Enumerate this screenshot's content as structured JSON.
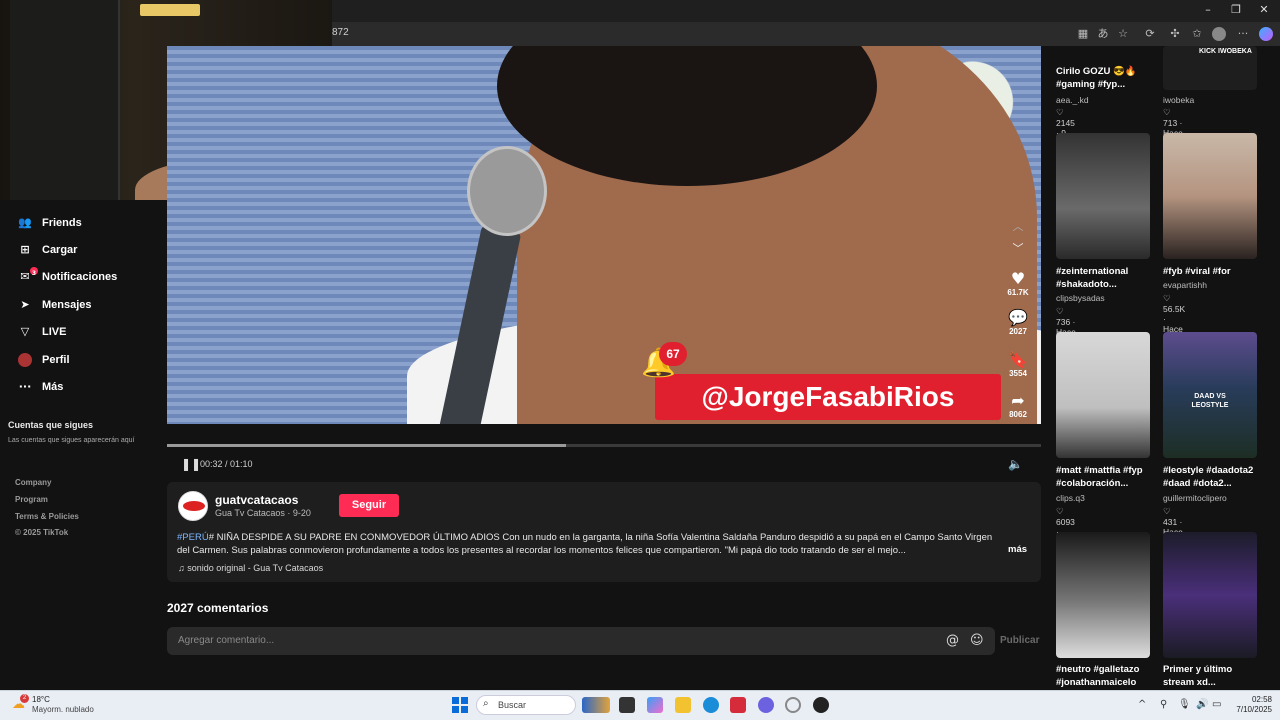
{
  "browser": {
    "url": "872",
    "icons": [
      "grid-icon",
      "translate-icon",
      "star-icon",
      "extension-icon",
      "puzzle-icon",
      "favorites-icon",
      "profile-icon",
      "more-icon",
      "copilot-icon"
    ]
  },
  "sidebar": {
    "items": [
      {
        "label": "Friends",
        "icon": "friends-icon"
      },
      {
        "label": "Cargar",
        "icon": "upload-icon"
      },
      {
        "label": "Notificaciones",
        "icon": "bell-icon",
        "badge": "3"
      },
      {
        "label": "Mensajes",
        "icon": "message-icon"
      },
      {
        "label": "LIVE",
        "icon": "live-icon"
      },
      {
        "label": "Perfil",
        "icon": "profile-icon"
      },
      {
        "label": "Más",
        "icon": "more-icon"
      }
    ],
    "following_title": "Cuentas que sigues",
    "following_note": "Las cuentas que sigues aparecerán aquí",
    "footer": [
      "Company",
      "Program",
      "Terms & Policies",
      "© 2025 TikTok"
    ]
  },
  "video": {
    "overlay_handle": "@JorgeFasabiRios",
    "bell_badge": "67",
    "likes": "61.7K",
    "comments": "2027",
    "saves": "3554",
    "shares": "8062",
    "time": "00:32 / 01:10",
    "progress": 0.457
  },
  "post": {
    "author_name": "guatvcatacaos",
    "author_meta": "Gua Tv Catacaos · 9-20",
    "follow_label": "Seguir",
    "hashtag": "#PERÚ",
    "description": "# NIÑA DESPIDE A SU PADRE EN CONMOVEDOR ÚLTIMO ADIOS Con un nudo en la garganta, la niña Sofía Valentina Saldaña Panduro despidió a su papá en el Campo Santo Virgen del Carmen. Sus palabras conmovieron profundamente a todos los presentes al recordar los momentos felices que compartieron. \"Mi papá dio todo tratando de ser el mejo...",
    "more_label": "más",
    "sound": "♫ sonido original - Gua Tv Catacaos"
  },
  "comments": {
    "count_label": "2027 comentarios",
    "placeholder": "Agregar comentario...",
    "publish_label": "Publicar"
  },
  "related": [
    {
      "title": "Cirilo GOZU 😎🔥 #gaming #fyp...",
      "author": "aea._.kd",
      "stats": "♡ 2145 · 9-25"
    },
    {
      "title": "",
      "author": "iwobeka",
      "stats": "♡ 713 · Hace 4 d",
      "thumb_text": "KICK IWOBEKA"
    },
    {
      "title": "#zeinternational #shakadoto...",
      "author": "clipsbysadas",
      "stats": "♡ 736 · Hace 2 d"
    },
    {
      "title": "#fyb #viral #for",
      "author": "evapartishh",
      "stats": "♡ 56.5K · Hace 2 d"
    },
    {
      "title": "#matt #mattfia #fyp #colaboración...",
      "author": "clips.q3",
      "stats": "♡ 6093 · Hace 2 d"
    },
    {
      "title": "#leostyle #daadota2 #daad #dota2...",
      "author": "guillermitoclipero",
      "stats": "♡ 431 · Hace 6 d",
      "thumb_text": "DAAD VS LEOSTYLE"
    },
    {
      "title": "#neutro #galletazo #jonathanmaicelo",
      "author": "",
      "stats": ""
    },
    {
      "title": "Primer y último stream xd...",
      "author": "",
      "stats": ""
    }
  ],
  "taskbar": {
    "weather_temp": "18°C",
    "weather_desc": "Mayorm. nublado",
    "weather_badge": "2",
    "search_label": "Buscar",
    "time": "02:58",
    "date": "7/10/2025"
  }
}
